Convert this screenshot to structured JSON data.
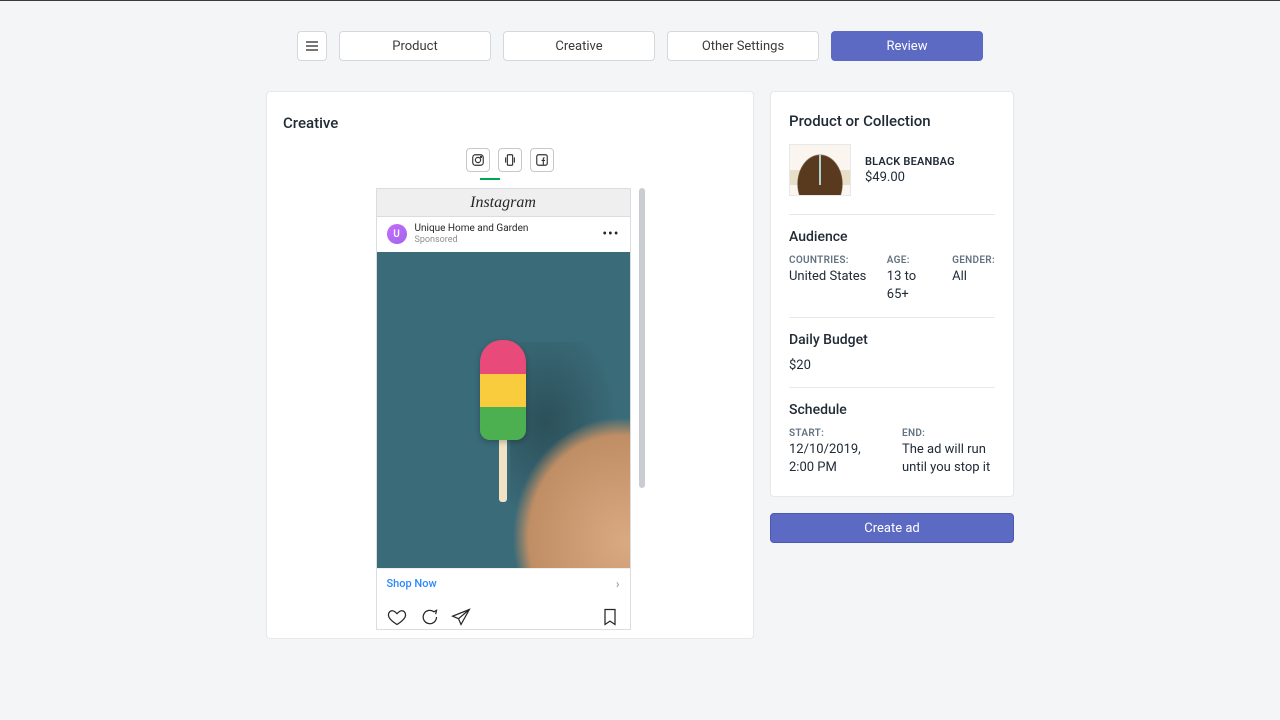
{
  "tabs": {
    "product": "Product",
    "creative": "Creative",
    "other": "Other Settings",
    "review": "Review"
  },
  "creative": {
    "heading": "Creative",
    "ig_brand": "Instagram",
    "account_name": "Unique Home and Garden",
    "sponsored": "Sponsored",
    "avatar_letter": "U",
    "cta_label": "Shop Now"
  },
  "summary": {
    "product_heading": "Product or Collection",
    "product_name": "BLACK BEANBAG",
    "product_price": "$49.00",
    "audience_heading": "Audience",
    "countries_label": "COUNTRIES:",
    "countries_value": "United States",
    "age_label": "AGE:",
    "age_value": "13 to 65+",
    "gender_label": "GENDER:",
    "gender_value": "All",
    "budget_heading": "Daily Budget",
    "budget_value": "$20",
    "schedule_heading": "Schedule",
    "start_label": "START:",
    "start_value": "12/10/2019, 2:00 PM",
    "end_label": "END:",
    "end_value": "The ad will run until you stop it"
  },
  "actions": {
    "create_ad": "Create ad"
  }
}
